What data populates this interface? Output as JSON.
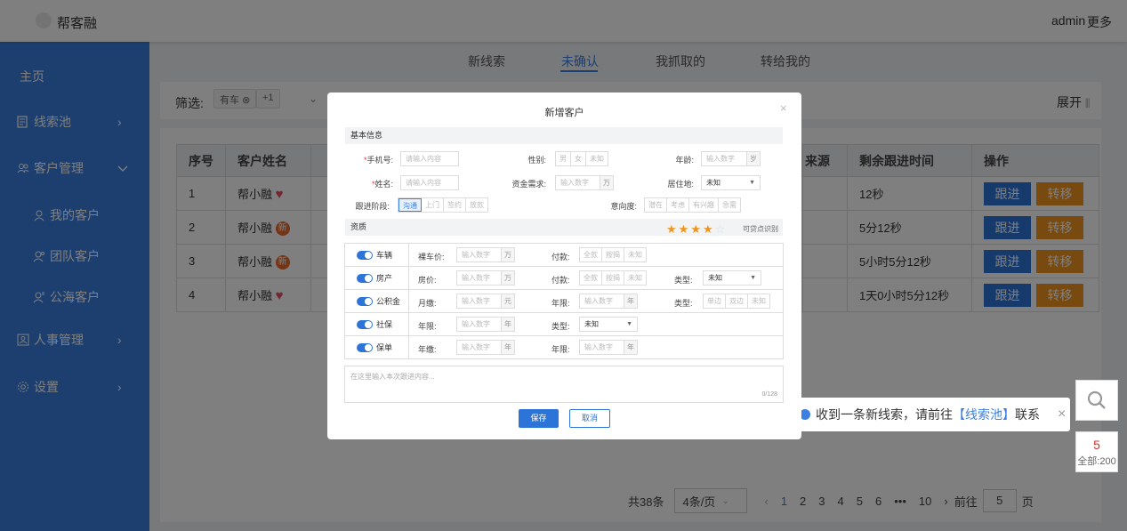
{
  "header": {
    "brand": "帮客融",
    "user": "admin",
    "more": "更多"
  },
  "sidebar": {
    "home": "主页",
    "items": [
      {
        "label": "线索池",
        "icon": "list-icon",
        "arrow": "›"
      },
      {
        "label": "客户管理",
        "icon": "users-icon",
        "arrow": "⌄"
      },
      {
        "label": "我的客户",
        "icon": "user-icon"
      },
      {
        "label": "团队客户",
        "icon": "team-icon"
      },
      {
        "label": "公海客户",
        "icon": "public-user-icon"
      },
      {
        "label": "人事管理",
        "icon": "hr-icon",
        "arrow": "›"
      },
      {
        "label": "设置",
        "icon": "gear-icon",
        "arrow": "›"
      }
    ]
  },
  "tabs": [
    "新线索",
    "未确认",
    "我抓取的",
    "转给我的"
  ],
  "active_tab": "未确认",
  "filter": {
    "label": "筛选:",
    "chip": "有车",
    "chip_more": "+1",
    "expand": "展开"
  },
  "table": {
    "headers": [
      "序号",
      "客户姓名",
      "来源",
      "剩余跟进时间",
      "操作"
    ],
    "rows": [
      {
        "index": "1",
        "name": "帮小融",
        "mark": "heart",
        "time": "12秒"
      },
      {
        "index": "2",
        "name": "帮小融",
        "mark": "新",
        "time": "5分12秒"
      },
      {
        "index": "3",
        "name": "帮小融",
        "mark": "新",
        "time": "5小时5分12秒"
      },
      {
        "index": "4",
        "name": "帮小融",
        "mark": "heart",
        "time": "1天0小时5分12秒"
      }
    ],
    "follow_label": "跟进",
    "move_label": "转移"
  },
  "pagination": {
    "total": "共38条",
    "page_size": "4条/页",
    "pages": [
      "1",
      "2",
      "3",
      "4",
      "5",
      "6",
      "•••",
      "10"
    ],
    "current": "1",
    "goto_label": "前往",
    "goto_value": "5",
    "page_suffix": "页"
  },
  "toast": {
    "prefix": "收到一条新线索，请前往",
    "link": "【线索池】",
    "suffix": "联系"
  },
  "float_count": {
    "num": "5",
    "all": "全部:200"
  },
  "modal": {
    "title": "新增客户",
    "section_basic": "基本信息",
    "phone_label": "手机号:",
    "phone_placeholder": "请输入内容",
    "gender_label": "性别:",
    "gender_options": [
      "男",
      "女",
      "未知"
    ],
    "age_label": "年龄:",
    "age_placeholder": "输入数字",
    "age_unit": "岁",
    "name_label": "姓名:",
    "name_placeholder": "请输入内容",
    "fund_label": "资金需求:",
    "fund_placeholder": "输入数字",
    "fund_unit": "万",
    "residence_label": "居住地:",
    "residence_value": "未知",
    "stage_label": "跟进阶段:",
    "stage_options": [
      "沟通",
      "上门",
      "签约",
      "放款"
    ],
    "stage_selected": "沟通",
    "intent_label": "意向度:",
    "intent_options": [
      "潜在",
      "考虑",
      "有兴趣",
      "急需"
    ],
    "section_assets": "资质",
    "stars": 4,
    "stars_text": "可贷点识别",
    "assets": [
      {
        "name": "车辆",
        "fields": [
          {
            "label": "裸车价:",
            "placeholder": "输入数字",
            "unit": "万"
          },
          {
            "label": "付款:",
            "options": [
              "全款",
              "按揭",
              "未知"
            ]
          }
        ]
      },
      {
        "name": "房产",
        "fields": [
          {
            "label": "房价:",
            "placeholder": "输入数字",
            "unit": "万"
          },
          {
            "label": "付款:",
            "options": [
              "全款",
              "按揭",
              "未知"
            ]
          },
          {
            "label": "类型:",
            "select": "未知"
          }
        ]
      },
      {
        "name": "公积金",
        "fields": [
          {
            "label": "月缴:",
            "placeholder": "输入数字",
            "unit": "元"
          },
          {
            "label": "年限:",
            "placeholder": "输入数字",
            "unit": "年"
          },
          {
            "label": "类型:",
            "options": [
              "单边",
              "双边",
              "未知"
            ]
          }
        ]
      },
      {
        "name": "社保",
        "fields": [
          {
            "label": "年限:",
            "placeholder": "输入数字",
            "unit": "年"
          },
          {
            "label": "类型:",
            "select": "未知"
          }
        ]
      },
      {
        "name": "保单",
        "fields": [
          {
            "label": "年缴:",
            "placeholder": "输入数字",
            "unit": "年"
          },
          {
            "label": "年限:",
            "placeholder": "输入数字",
            "unit": "年"
          }
        ]
      }
    ],
    "note_placeholder": "在这里输入本次跟进内容...",
    "note_count": "0/128",
    "save": "保存",
    "cancel": "取消"
  }
}
